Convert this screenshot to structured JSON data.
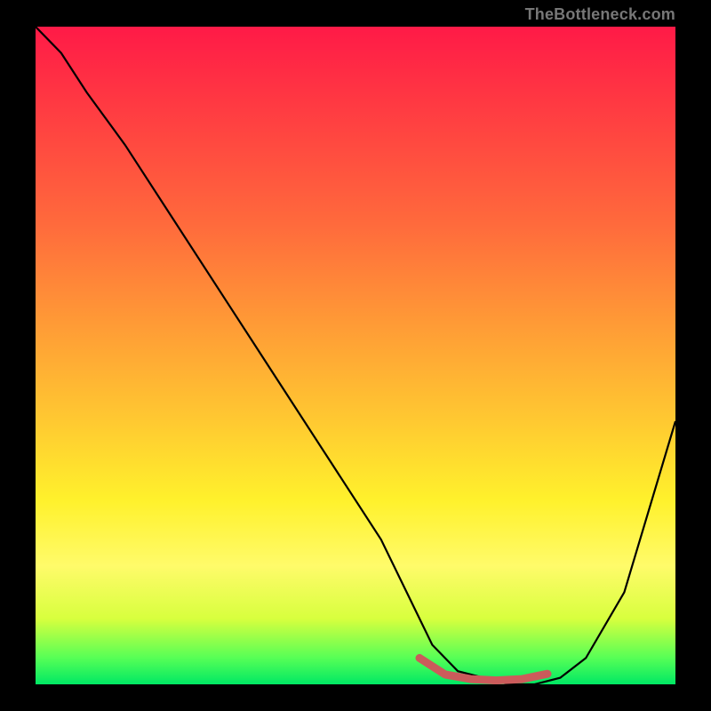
{
  "watermark": "TheBottleneck.com",
  "chart_data": {
    "type": "line",
    "title": "",
    "xlabel": "",
    "ylabel": "",
    "xlim": [
      0,
      100
    ],
    "ylim": [
      0,
      100
    ],
    "series": [
      {
        "name": "curve",
        "x": [
          0,
          4,
          8,
          14,
          22,
          30,
          38,
          46,
          54,
          58,
          62,
          66,
          70,
          74,
          78,
          82,
          86,
          92,
          100
        ],
        "y": [
          100,
          96,
          90,
          82,
          70,
          58,
          46,
          34,
          22,
          14,
          6,
          2,
          1,
          0,
          0,
          1,
          4,
          14,
          40
        ]
      },
      {
        "name": "highlight",
        "x": [
          60,
          64,
          68,
          72,
          76,
          80
        ],
        "y": [
          4,
          1.5,
          0.8,
          0.6,
          0.8,
          1.6
        ]
      }
    ]
  }
}
